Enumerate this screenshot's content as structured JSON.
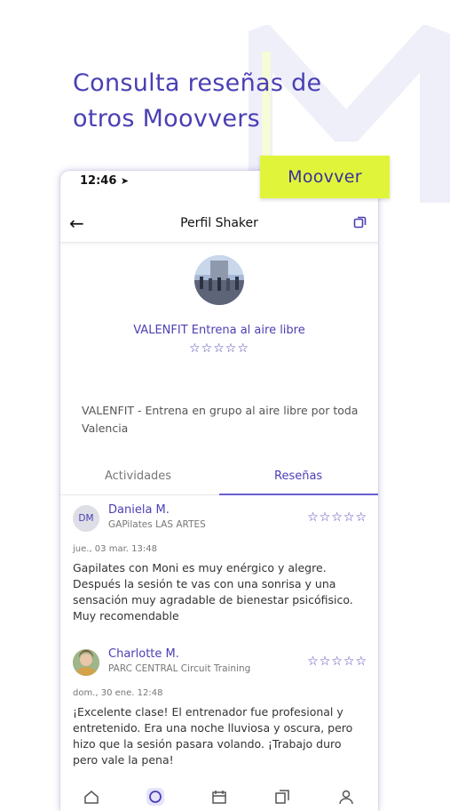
{
  "headline": "Consulta reseñas de otros Moovvers",
  "tag_label": "Moovver",
  "status_time": "12:46",
  "appbar_title": "Perfil Shaker",
  "profile": {
    "name": "VALENFIT Entrena al aire libre",
    "rating_stars": "☆☆☆☆☆",
    "description": "VALENFIT - Entrena en grupo al aire libre por toda Valencia"
  },
  "tabs": [
    "Actividades",
    "Reseñas"
  ],
  "active_tab": 1,
  "reviews": [
    {
      "initials": "DM",
      "name": "Daniela  M.",
      "activity": "GAPilates LAS ARTES",
      "stars": "☆☆☆☆☆",
      "date": "jue., 03 mar. 13:48",
      "text": "Gapilates con Moni es muy enérgico y alegre. Después la sesión te vas con una sonrisa y una sensación muy agradable de bienestar psicófisico. Muy recomendable"
    },
    {
      "initials": "",
      "name": "Charlotte M.",
      "activity": "PARC CENTRAL Circuit Training",
      "stars": "☆☆☆☆☆",
      "date": "dom., 30 ene. 12:48",
      "text": "¡Excelente clase! El entrenador fue profesional y entretenido. Era una noche lluviosa y oscura, pero hizo que la sesión pasara volando. ¡Trabajo duro pero vale la pena!"
    }
  ],
  "colors": {
    "brand": "#4a3fb4",
    "accent": "#e0f53a"
  },
  "icons": [
    "back-arrow-icon",
    "copy-icon",
    "home-icon",
    "search-icon",
    "calendar-icon",
    "pages-icon",
    "profile-icon"
  ]
}
